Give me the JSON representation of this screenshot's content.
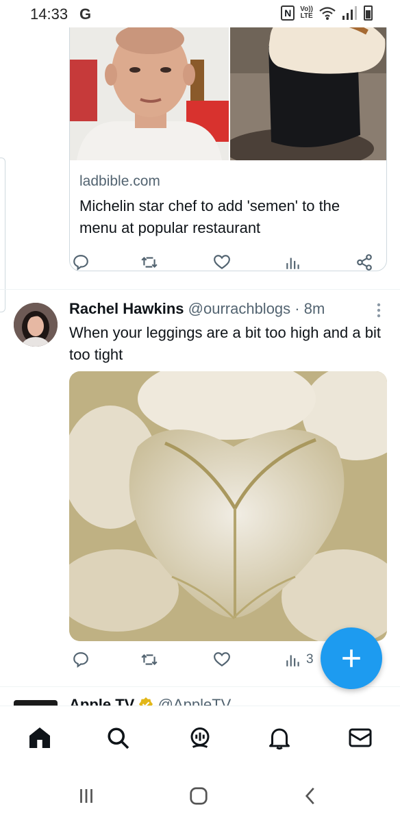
{
  "status_bar": {
    "time": "14:33",
    "carrier_icon": "G",
    "nfc_icon": "N",
    "volte_top": "Vo))",
    "volte_bottom": "LTE"
  },
  "tweets": [
    {
      "link_card": {
        "domain": "ladbible.com",
        "title": "Michelin star chef to add 'semen' to the menu at popular restaurant"
      },
      "actions": {
        "reply": "",
        "retweet": "",
        "like": "",
        "views": "",
        "share": ""
      }
    },
    {
      "author_name": "Rachel Hawkins",
      "author_handle": "@ourrachblogs",
      "separator": "·",
      "time_ago": "8m",
      "text": "When your leggings are a bit too high and a bit too tight",
      "actions": {
        "reply": "",
        "retweet": "",
        "like": "",
        "views": "3"
      }
    },
    {
      "author_name": "Apple TV",
      "author_handle": "@AppleTV"
    }
  ],
  "icons": {
    "reply": "reply-icon",
    "retweet": "retweet-icon",
    "like": "heart-icon",
    "views": "views-icon",
    "share": "share-icon",
    "compose": "plus-icon",
    "nav_home": "home-icon",
    "nav_search": "search-icon",
    "nav_spaces": "spaces-icon",
    "nav_notifications": "bell-icon",
    "nav_messages": "mail-icon"
  },
  "colors": {
    "accent": "#1d9bf0",
    "text_primary": "#0f1419",
    "text_secondary": "#536471",
    "verified_badge": "#e2b719"
  }
}
